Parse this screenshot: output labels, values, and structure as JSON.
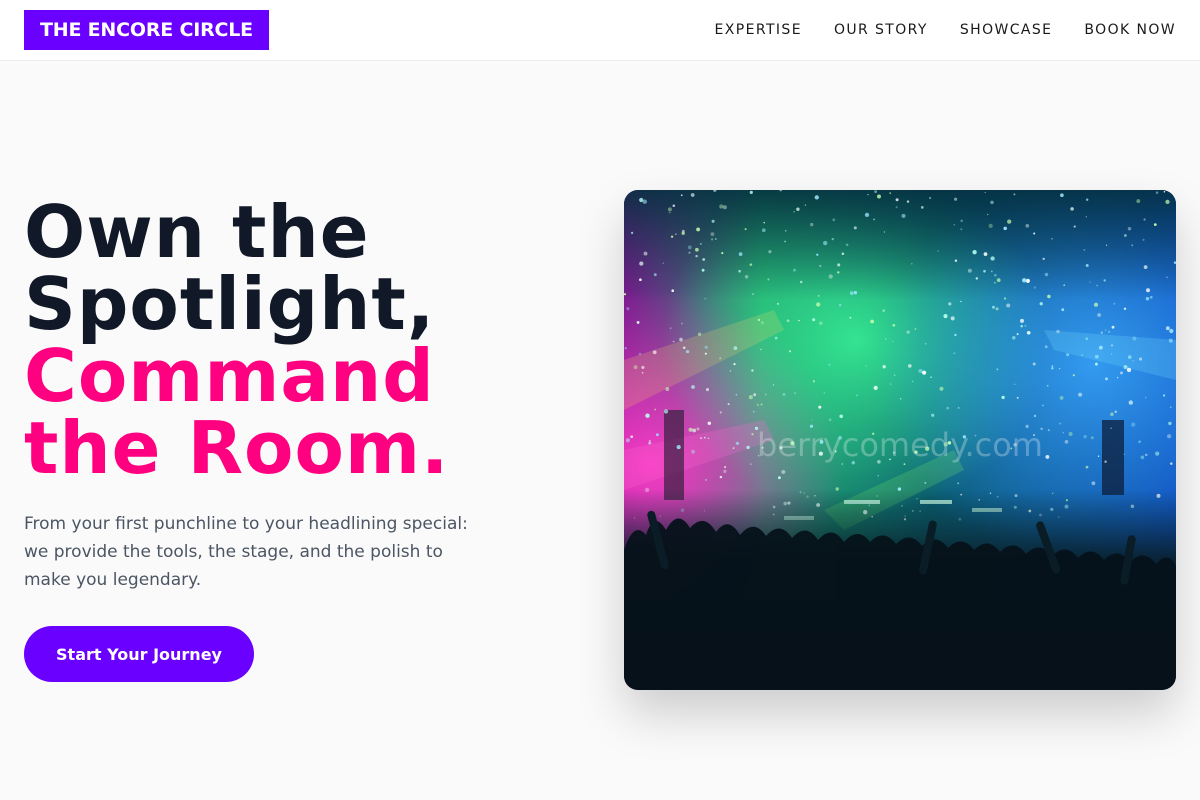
{
  "header": {
    "logo": "THE ENCORE CIRCLE",
    "nav": [
      "EXPERTISE",
      "OUR STORY",
      "SHOWCASE",
      "BOOK NOW"
    ]
  },
  "hero": {
    "headline": {
      "line1": "Own the",
      "line2": "Spotlight,",
      "line3": "Command",
      "line4": "the Room."
    },
    "subtext": "From your first punchline to your headlining special: we provide the tools, the stage, and the polish to make you legendary.",
    "cta_label": "Start Your Journey",
    "image": {
      "subject": "concert crowd under colorful stage lights and confetti",
      "watermark": "berrycomedy.com"
    }
  },
  "colors": {
    "brand_purple": "#6a00ff",
    "accent_pink": "#ff0080",
    "headline_dark": "#111827",
    "body_gray": "#4b5563",
    "page_bg": "#fafafa"
  }
}
